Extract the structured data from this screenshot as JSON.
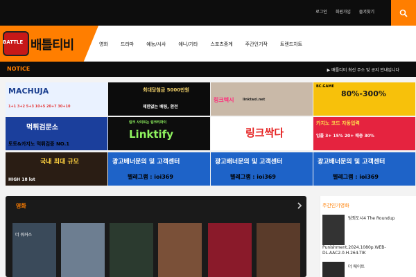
{
  "header": {
    "links": [
      "로그인",
      "회원가입",
      "즐겨찾기"
    ],
    "logo_text": "배틀티비",
    "logo_badge": "BATTLE"
  },
  "nav": {
    "items": [
      "영화",
      "드라마",
      "예능/시사",
      "애니/기타",
      "스포츠중계",
      "주간인기작",
      "트렌드차트"
    ]
  },
  "notice": {
    "label": "NOTICE",
    "text": "▶ 배틀티비 최신 주소 및 공지 안내입니다"
  },
  "banners": [
    {
      "text": "MACHUJA",
      "sub": "1+1 3+2 5+3 10+5 20+7 30+10",
      "bg": "#eaf2ff",
      "color": "#1b3f8f"
    },
    {
      "text": "최대당첨금 5000만원",
      "sub": "제한없는 배팅, 환전",
      "bg": "#0c0c0c",
      "color": "#f4d36b"
    },
    {
      "text": "링크텍시",
      "sub": "linktaxi.net",
      "bg": "#c9b9a8",
      "color": "#ff2a7a"
    },
    {
      "text": "80%-300%",
      "sub": "BC.GAME",
      "bg": "#f7c10b",
      "color": "#1a1a1a"
    },
    {
      "text": "먹튀검문소",
      "sub": "토토&카지노 먹튀검증 NO.1",
      "bg": "#1b3f9c",
      "color": "#ffffff"
    },
    {
      "text": "Linktify",
      "sub": "링크 사이트는 링크티파이",
      "bg": "#0d0d0d",
      "color": "#8ff35f"
    },
    {
      "text": "링크싹다",
      "sub": "",
      "bg": "#ffffff",
      "color": "#e52323"
    },
    {
      "text": "카지노 코드 자동입력",
      "sub": "입플 3+ 15% 20+ 매충 30%",
      "bg": "#e5233f",
      "color": "#ffe14d"
    },
    {
      "text": "국내 최대 규모",
      "sub": "HIGH 18 lot",
      "bg": "#2a1d14",
      "color": "#ffd23f"
    },
    {
      "text": "광고배너문의 및 고객센터",
      "sub": "텔레그램 : ioi369",
      "bg": "#1e63c8",
      "color": "#ffffff"
    },
    {
      "text": "광고배너문의 및 고객센터",
      "sub": "텔레그램 : ioi369",
      "bg": "#1e63c8",
      "color": "#ffffff"
    },
    {
      "text": "광고배너문의 및 고객센터",
      "sub": "텔레그램 : ioi369",
      "bg": "#1e63c8",
      "color": "#ffffff"
    }
  ],
  "movies_section": {
    "title": "영화",
    "posters": [
      {
        "label": "더 워커스",
        "bg": "#3a4a5a"
      },
      {
        "label": "",
        "bg": "#6d7e91"
      },
      {
        "label": "",
        "bg": "#2b3a2f"
      },
      {
        "label": "",
        "bg": "#7a5038"
      },
      {
        "label": "",
        "bg": "#8a1a2a"
      },
      {
        "label": "",
        "bg": "#5a3b2a"
      }
    ]
  },
  "weekly": {
    "title": "주간인기영화",
    "item1_title": "범죄도시4 The Roundup",
    "item1_sub": "Punishment.2024.1080p.WEB-DL.AAC2.0.H.264-TIK",
    "item2_title": "더 에이트"
  },
  "colors": {
    "accent": "#ff7e00",
    "dark": "#0d0d0d"
  }
}
